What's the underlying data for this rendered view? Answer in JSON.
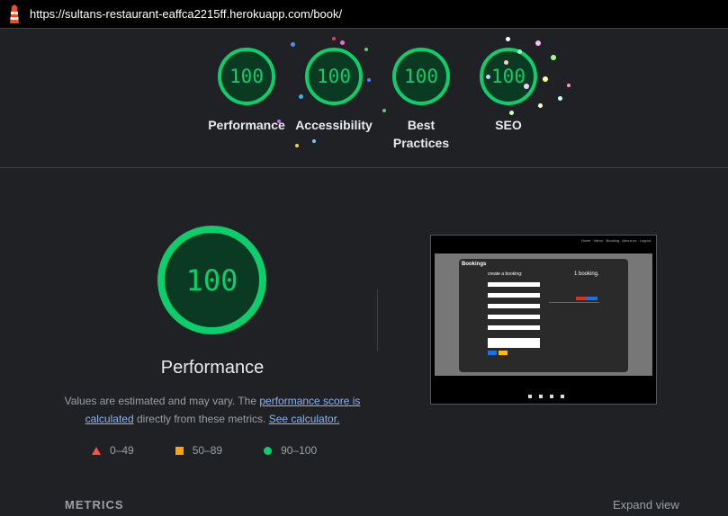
{
  "url": "https://sultans-restaurant-eaffca2215ff.herokuapp.com/book/",
  "scores": [
    {
      "label": "Performance",
      "value": "100"
    },
    {
      "label": "Accessibility",
      "value": "100"
    },
    {
      "label": "Best Practices",
      "value": "100"
    },
    {
      "label": "SEO",
      "value": "100"
    }
  ],
  "main": {
    "score": "100",
    "title": "Performance",
    "desc_prefix": "Values are estimated and may vary. The ",
    "desc_link1": "performance score is calculated",
    "desc_mid": " directly from these metrics. ",
    "desc_link2": "See calculator."
  },
  "legend": [
    {
      "range": "0–49",
      "color": "#ff4e42"
    },
    {
      "range": "50–89",
      "color": "#ffa400"
    },
    {
      "range": "90–100",
      "color": "#0cce6b"
    }
  ],
  "metrics_label": "METRICS",
  "expand_label": "Expand view",
  "accent": "#0cce6b"
}
